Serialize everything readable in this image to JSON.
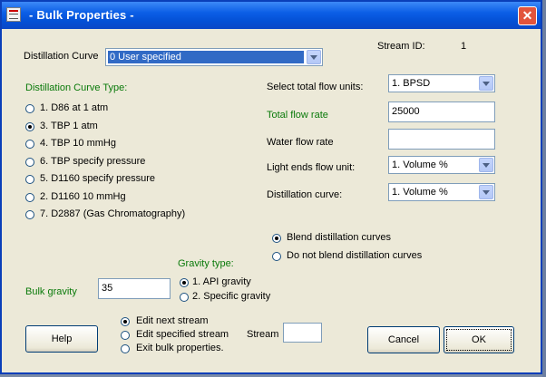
{
  "window": {
    "title": "- Bulk Properties -"
  },
  "stream_id": {
    "label": "Stream ID:",
    "value": "1"
  },
  "distillation_curve": {
    "label": "Distillation Curve",
    "selected": "0 User specified"
  },
  "curve_type": {
    "heading": "Distillation Curve Type:",
    "options": [
      {
        "label": "1. D86 at 1 atm",
        "checked": false
      },
      {
        "label": "3. TBP 1 atm",
        "checked": true
      },
      {
        "label": "4. TBP 10 mmHg",
        "checked": false
      },
      {
        "label": "6. TBP specify pressure",
        "checked": false
      },
      {
        "label": "5. D1160 specify pressure",
        "checked": false
      },
      {
        "label": "2. D1160 10 mmHg",
        "checked": false
      },
      {
        "label": "7. D2887 (Gas Chromatography)",
        "checked": false
      }
    ]
  },
  "flow": {
    "units_label": "Select total flow units:",
    "units_value": "1. BPSD",
    "total_label": "Total flow rate",
    "total_value": "25000",
    "water_label": "Water flow rate",
    "water_value": "",
    "light_ends_label": "Light ends flow unit:",
    "light_ends_value": "1. Volume %",
    "distillation_label": "Distillation curve:",
    "distillation_value": "1. Volume %"
  },
  "blend": {
    "options": [
      {
        "label": "Blend distillation curves",
        "checked": true
      },
      {
        "label": "Do not blend distillation curves",
        "checked": false
      }
    ]
  },
  "gravity": {
    "type_heading": "Gravity type:",
    "options": [
      {
        "label": "1. API gravity",
        "checked": true
      },
      {
        "label": "2. Specific gravity",
        "checked": false
      }
    ],
    "bulk_label": "Bulk gravity",
    "bulk_value": "35"
  },
  "next_action": {
    "options": [
      {
        "label": "Edit next stream",
        "checked": true
      },
      {
        "label": "Edit specified stream",
        "checked": false
      },
      {
        "label": "Exit bulk properties.",
        "checked": false
      }
    ],
    "stream_label": "Stream",
    "stream_value": ""
  },
  "buttons": {
    "help": "Help",
    "cancel": "Cancel",
    "ok": "OK"
  },
  "colors": {
    "title_bar": "#0b5ee6",
    "dialog_bg": "#ece9d8",
    "green_label": "#0a7a0a",
    "close": "#e2543c"
  }
}
